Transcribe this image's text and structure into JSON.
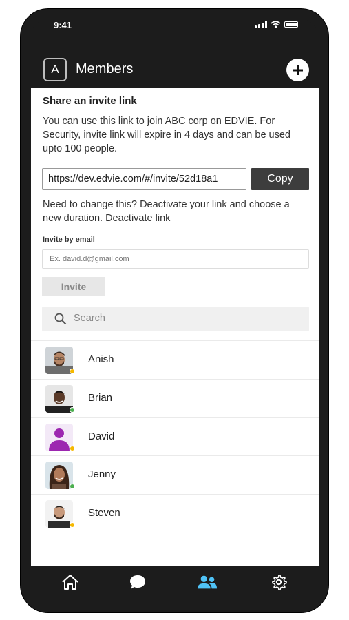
{
  "status": {
    "time": "9:41"
  },
  "header": {
    "avatar_letter": "A",
    "title": "Members"
  },
  "invite_link": {
    "title": "Share an invite link",
    "description": "You can use this link to join ABC corp on EDVIE. For Security, invite link will expire in 4 days and can be used upto 100 people.",
    "url": "https://dev.edvie.com/#/invite/52d18a1",
    "copy_label": "Copy",
    "change_text": "Need to change this? Deactivate your link and choose a new duration. Deactivate link"
  },
  "invite_email": {
    "label": "Invite by email",
    "placeholder": "Ex. david.d@gmail.com",
    "button_label": "Invite"
  },
  "search": {
    "placeholder": "Search"
  },
  "members": [
    {
      "name": "Anish",
      "presence": "away",
      "presence_color": "#f5b800",
      "avatar_icon": "photo-avatar-icon"
    },
    {
      "name": "Brian",
      "presence": "online",
      "presence_color": "#4caf50",
      "avatar_icon": "photo-avatar-icon"
    },
    {
      "name": "David",
      "presence": "away",
      "presence_color": "#f5b800",
      "avatar_icon": "default-user-icon",
      "avatar_color": "#9c27b0"
    },
    {
      "name": "Jenny",
      "presence": "online",
      "presence_color": "#4caf50",
      "avatar_icon": "photo-avatar-icon"
    },
    {
      "name": "Steven",
      "presence": "away",
      "presence_color": "#f5b800",
      "avatar_icon": "photo-avatar-icon"
    }
  ],
  "tabbar": {
    "tabs": [
      {
        "icon": "home-icon",
        "active": false
      },
      {
        "icon": "chat-icon",
        "active": false
      },
      {
        "icon": "members-icon",
        "active": true
      },
      {
        "icon": "settings-icon",
        "active": false
      }
    ],
    "active_color": "#4fc3f7",
    "inactive_color": "#ffffff"
  }
}
